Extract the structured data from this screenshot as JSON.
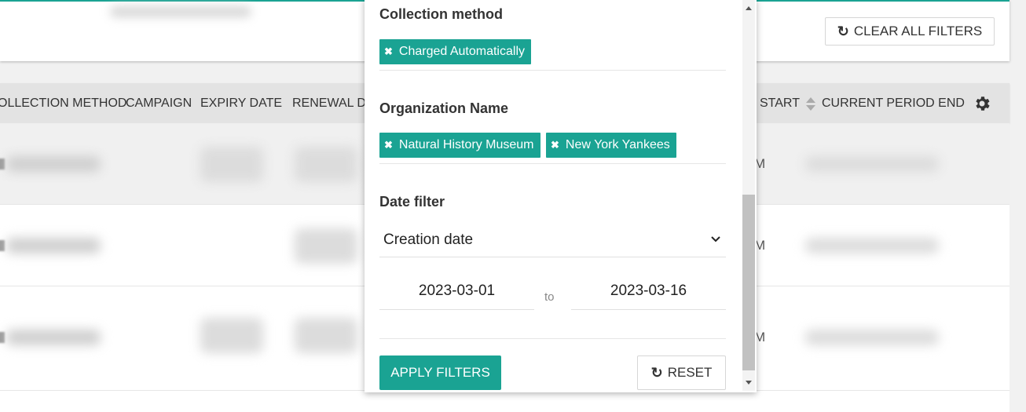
{
  "toolbar": {
    "clear_all_filters_label": "CLEAR ALL FILTERS"
  },
  "table": {
    "columns": [
      "OLLECTION METHOD",
      "CAMPAIGN",
      "EXPIRY DATE",
      "RENEWAL DA",
      "START",
      "CURRENT PERIOD END"
    ],
    "row_edge_glyphs": [
      "M",
      "M",
      "M"
    ]
  },
  "filter_panel": {
    "collection_method": {
      "label": "Collection method",
      "chips": [
        "Charged Automatically"
      ]
    },
    "organization_name": {
      "label": "Organization Name",
      "chips": [
        "Natural History Museum",
        "New York Yankees"
      ]
    },
    "date_filter": {
      "label": "Date filter",
      "selected": "Creation date",
      "from": "2023-03-01",
      "to_label": "to",
      "to": "2023-03-16"
    },
    "apply_label": "APPLY FILTERS",
    "reset_label": "RESET"
  },
  "colors": {
    "accent": "#1aa393",
    "header_bg": "#e3e3e3"
  },
  "icons": [
    "refresh-icon",
    "sort-icon",
    "gear-icon",
    "close-icon",
    "chevron-down-icon"
  ]
}
